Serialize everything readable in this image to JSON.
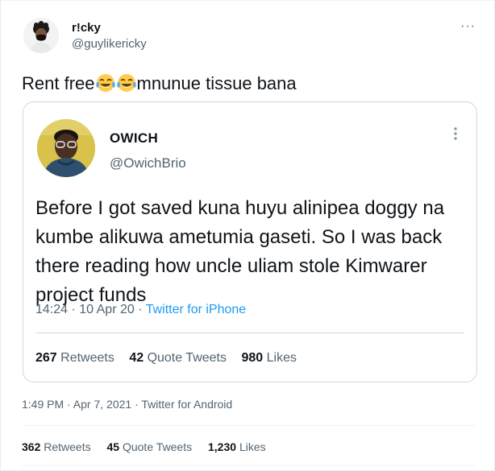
{
  "tweet": {
    "author_name": "r!cky",
    "author_handle": "@guylikericky",
    "more_glyph": "···",
    "text_before": "Rent free",
    "text_after": "mnunue tissue bana",
    "emoji": "face-with-tears-of-joy",
    "timestamp": "1:49 PM · Apr 7, 2021 · Twitter for Android",
    "stats": {
      "retweets_count": "362",
      "retweets_label": "Retweets",
      "quotes_count": "45",
      "quotes_label": "Quote Tweets",
      "likes_count": "1,230",
      "likes_label": "Likes"
    }
  },
  "quoted": {
    "author_name": "OWICH",
    "author_handle": "@OwichBrio",
    "text": "Before I got saved kuna huyu alinipea doggy na kumbe alikuwa ametumia gaseti. So I was back there reading how uncle uliam stole Kimwarer project funds",
    "time": "14:24 · 10 Apr 20 · ",
    "source": "Twitter for iPhone",
    "stats": {
      "retweets_count": "267",
      "retweets_label": "Retweets",
      "quotes_count": "42",
      "quotes_label": "Quote Tweets",
      "likes_count": "980",
      "likes_label": "Likes"
    }
  },
  "colors": {
    "link": "#1d9bf0",
    "secondary_text": "#536471",
    "border": "#cfd9de"
  }
}
